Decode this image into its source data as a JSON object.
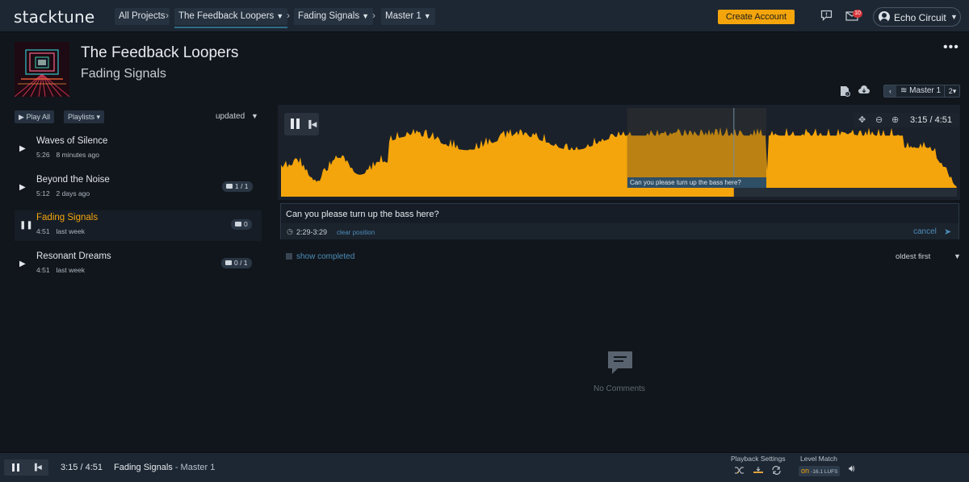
{
  "app": {
    "logo": "stacktune"
  },
  "breadcrumbs": [
    {
      "label": "All Projects"
    },
    {
      "label": "The Feedback Loopers"
    },
    {
      "label": "Fading Signals"
    },
    {
      "label": "Master 1"
    }
  ],
  "topbar": {
    "create_account": "Create Account",
    "notifications_count": "10",
    "user_name": "Echo Circuit"
  },
  "header": {
    "project_title": "The Feedback Loopers",
    "song_title": "Fading Signals"
  },
  "tracklist": {
    "play_all": "Play All",
    "playlists": "Playlists",
    "sort": "updated",
    "tracks": [
      {
        "name": "Waves of Silence",
        "duration": "5:26",
        "updated": "8 minutes ago",
        "comments": "",
        "state": "stopped"
      },
      {
        "name": "Beyond the Noise",
        "duration": "5:12",
        "updated": "2 days ago",
        "comments": "1 / 1",
        "state": "stopped"
      },
      {
        "name": "Fading Signals",
        "duration": "4:51",
        "updated": "last week",
        "comments": "0",
        "state": "playing"
      },
      {
        "name": "Resonant Dreams",
        "duration": "4:51",
        "updated": "last week",
        "comments": "0 / 1",
        "state": "stopped"
      }
    ]
  },
  "version": {
    "label": "Master 1",
    "number": "2"
  },
  "player": {
    "time": "3:15 / 4:51",
    "progress": 0.67,
    "region_start": 0.512,
    "region_end": 0.718,
    "region_comment": "Can you please turn up the bass here?"
  },
  "comment_form": {
    "value": "Can you please turn up the bass here?",
    "range": "2:29-3:29",
    "clear_position": "clear position",
    "cancel": "cancel"
  },
  "comments": {
    "show_completed": "show completed",
    "sort": "oldest first",
    "empty_text": "No Comments"
  },
  "bottombar": {
    "time": "3:15 / 4:51",
    "track": "Fading Signals",
    "version": " - Master 1",
    "playback_settings": "Playback Settings",
    "level_match": "Level Match",
    "level_on": "on",
    "lufs": "-16.1 LUFS"
  },
  "colors": {
    "accent": "#f4a50c",
    "link": "#4d8db8",
    "topbar": "#1d2733",
    "background": "#11161c"
  }
}
